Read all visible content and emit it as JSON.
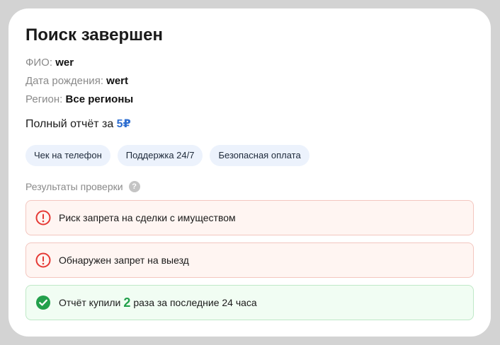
{
  "header": {
    "title": "Поиск завершен"
  },
  "person": {
    "fio_label": "ФИО:",
    "fio_value": "wer",
    "birth_label": "Дата рождения:",
    "birth_value": "wert",
    "region_label": "Регион:",
    "region_value": "Все регионы"
  },
  "price": {
    "label": "Полный отчёт за",
    "amount": "5₽"
  },
  "chips": [
    {
      "label": "Чек на телефон"
    },
    {
      "label": "Поддержка 24/7"
    },
    {
      "label": "Безопасная оплата"
    }
  ],
  "results": {
    "header": "Результаты проверки",
    "help_icon": "?",
    "items": [
      {
        "type": "danger",
        "icon": "exclamation-circle-icon",
        "text": "Риск запрета на сделки с имуществом"
      },
      {
        "type": "danger",
        "icon": "exclamation-circle-icon",
        "text": "Обнаружен запрет на выезд"
      },
      {
        "type": "success",
        "icon": "check-circle-icon",
        "text_before": "Отчёт купили",
        "count": "2",
        "text_after": "раза за последние 24 часа"
      }
    ]
  },
  "colors": {
    "background": "#d3d3d3",
    "card": "#ffffff",
    "accent_blue": "#2f6fd0",
    "danger": "#e53935",
    "success": "#22a04b",
    "chip_bg": "#ecf2fc"
  }
}
